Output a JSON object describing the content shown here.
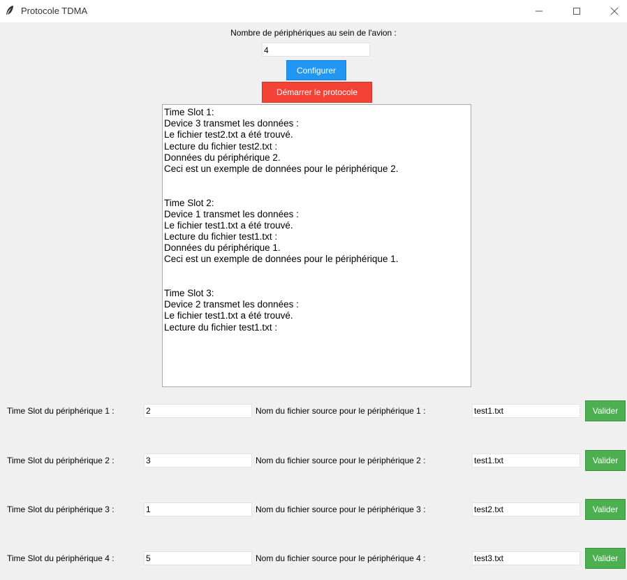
{
  "window": {
    "title": "Protocole TDMA",
    "icon": "feather-icon"
  },
  "config": {
    "label": "Nombre de périphériques au sein de l'avion :",
    "value": "4",
    "configure_label": "Configurer",
    "start_label": "Démarrer le protocole"
  },
  "log": {
    "lines": [
      "Time Slot 1:",
      "Device 3 transmet les données :",
      "Le fichier test2.txt a été trouvé.",
      "Lecture du fichier test2.txt :",
      "Données du périphérique 2.",
      "Ceci est un exemple de données pour le périphérique 2.",
      "",
      "",
      "Time Slot 2:",
      "Device 1 transmet les données :",
      "Le fichier test1.txt a été trouvé.",
      "Lecture du fichier test1.txt :",
      "Données du périphérique 1.",
      "Ceci est un exemple de données pour le périphérique 1.",
      "",
      "",
      "Time Slot 3:",
      "Device 2 transmet les données :",
      "Le fichier test1.txt a été trouvé.",
      "Lecture du fichier test1.txt :"
    ]
  },
  "devices": [
    {
      "ts_label": "Time Slot du périphérique 1 :",
      "ts_value": "2",
      "file_label": "Nom du fichier source pour le périphérique 1 :",
      "file_value": "test1.txt",
      "validate_label": "Valider"
    },
    {
      "ts_label": "Time Slot du périphérique 2 :",
      "ts_value": "3",
      "file_label": "Nom du fichier source pour le périphérique 2 :",
      "file_value": "test1.txt",
      "validate_label": "Valider"
    },
    {
      "ts_label": "Time Slot du périphérique 3 :",
      "ts_value": "1",
      "file_label": "Nom du fichier source pour le périphérique 3 :",
      "file_value": "test2.txt",
      "validate_label": "Valider"
    },
    {
      "ts_label": "Time Slot du périphérique 4 :",
      "ts_value": "5",
      "file_label": "Nom du fichier source pour le périphérique 4 :",
      "file_value": "test3.txt",
      "validate_label": "Valider"
    }
  ],
  "colors": {
    "configure": "#2196f3",
    "start": "#f44336",
    "validate": "#4caf50"
  }
}
